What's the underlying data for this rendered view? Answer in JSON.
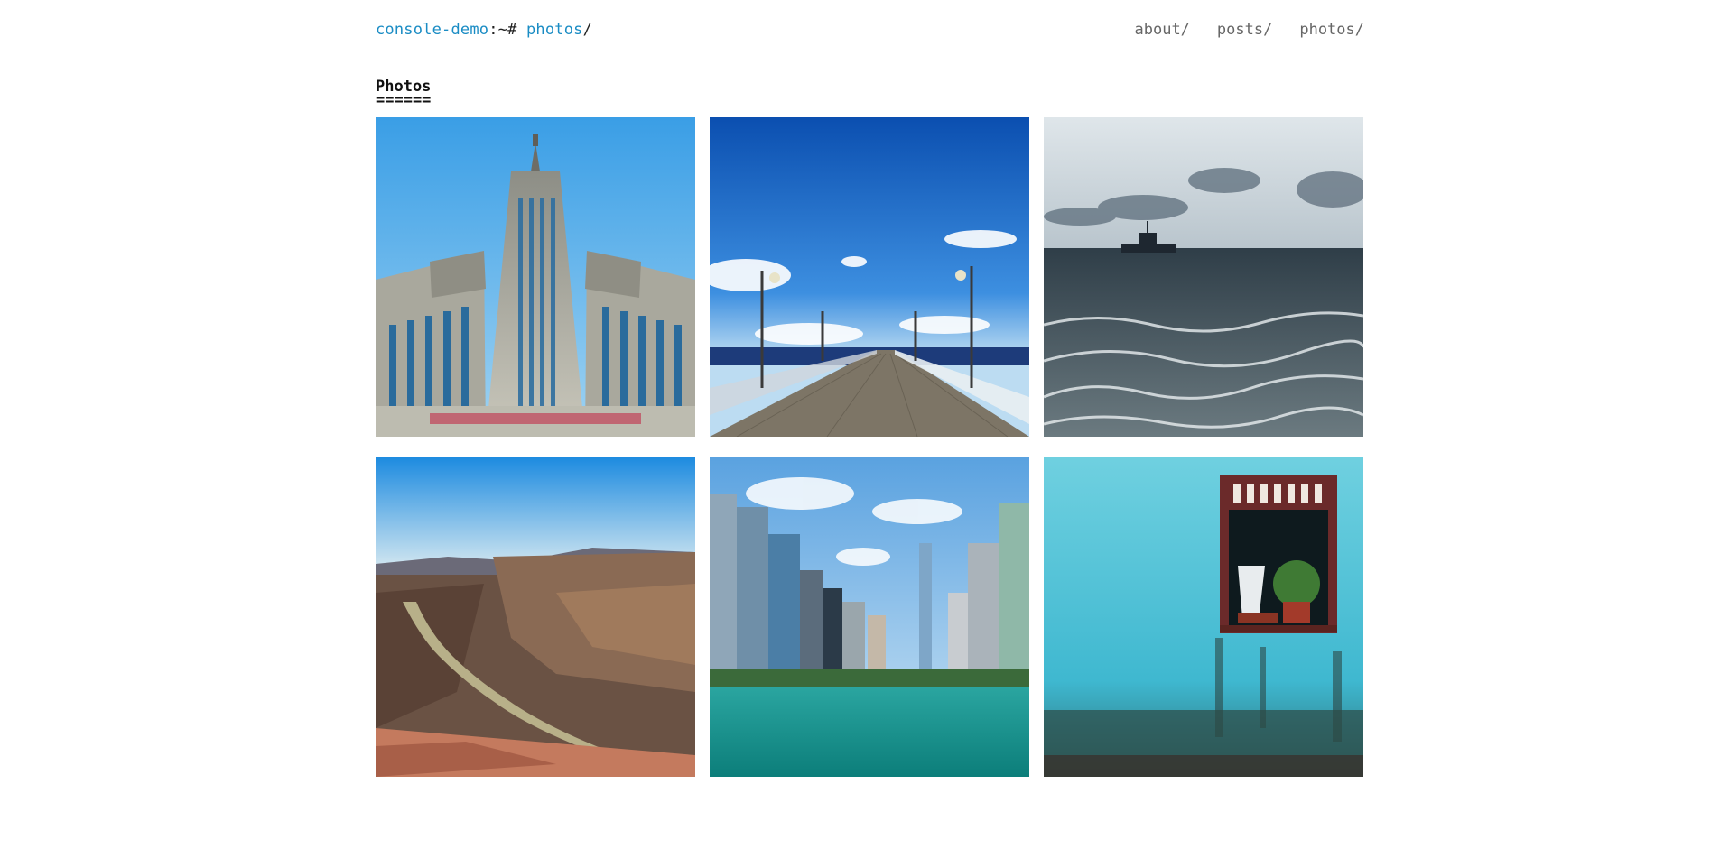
{
  "header": {
    "site_name": "console-demo",
    "prompt_sep": ":~# ",
    "current_path": "photos",
    "trailing_slash": "/"
  },
  "nav": [
    {
      "label": "about/"
    },
    {
      "label": "posts/"
    },
    {
      "label": "photos/"
    }
  ],
  "section": {
    "title": "Photos",
    "underline": "======"
  },
  "photos": [
    {
      "subject": "skyscraper-palace"
    },
    {
      "subject": "pier-boardwalk"
    },
    {
      "subject": "stormy-sea-ship"
    },
    {
      "subject": "canyon-river"
    },
    {
      "subject": "city-river-skyline"
    },
    {
      "subject": "turquoise-wall-window"
    }
  ],
  "colors": {
    "link": "#1a8cc4",
    "nav": "#666666",
    "text": "#222222"
  }
}
